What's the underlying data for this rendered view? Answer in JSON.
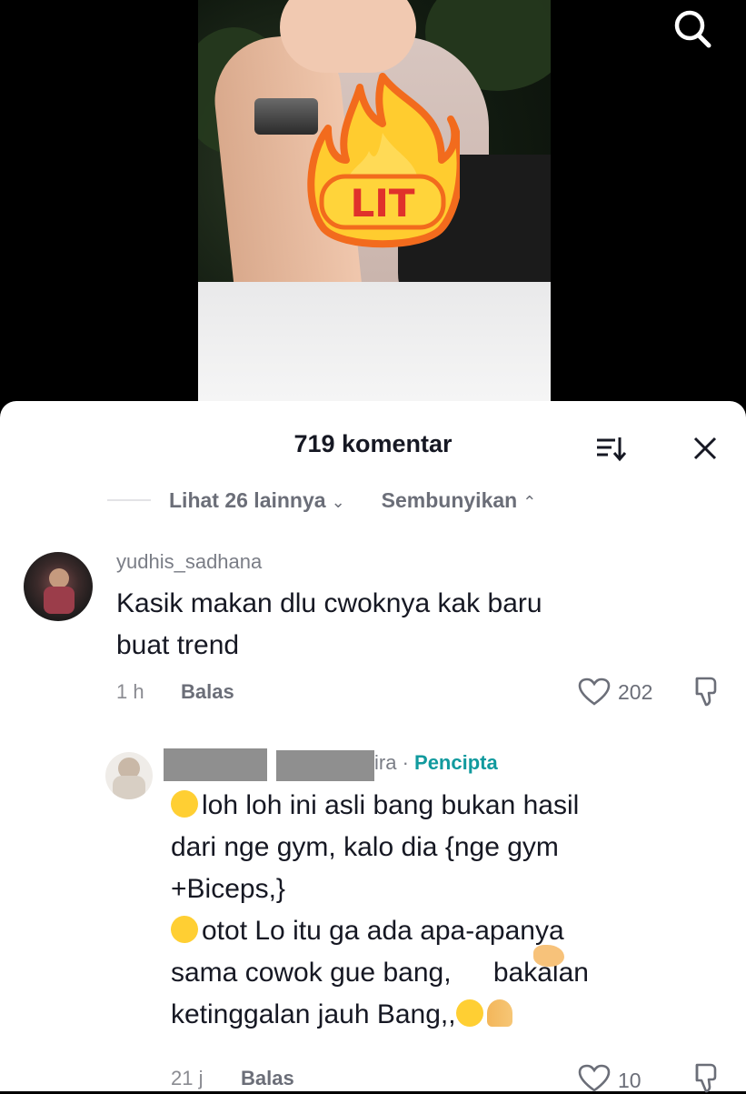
{
  "video": {
    "sticker_text": "LIT"
  },
  "comments_panel": {
    "title": "719 komentar",
    "see_more": "Lihat 26 lainnya",
    "hide": "Sembunyikan"
  },
  "comments": [
    {
      "username": "yudhis_sadhana",
      "lines": [
        "Kasik makan dlu cwoknya kak baru",
        "buat trend"
      ],
      "time": "1 h",
      "reply_label": "Balas",
      "likes": "202"
    },
    {
      "username_suffix": "ira",
      "separator": " · ",
      "creator_label": "Pencipta",
      "lines": [
        "loh loh ini asli bang bukan hasil",
        "dari nge gym, kalo dia {nge gym",
        "+Biceps,}",
        "otot Lo itu ga ada apa-apanya",
        "sama cowok gue bang,",
        " bakalan",
        "ketinggalan jauh Bang,,"
      ],
      "time": "21 j",
      "reply_label": "Balas",
      "likes": "10"
    }
  ],
  "colors": {
    "creator_accent": "#119a9e",
    "text_primary": "#161823",
    "text_secondary": "#6b6e78"
  }
}
